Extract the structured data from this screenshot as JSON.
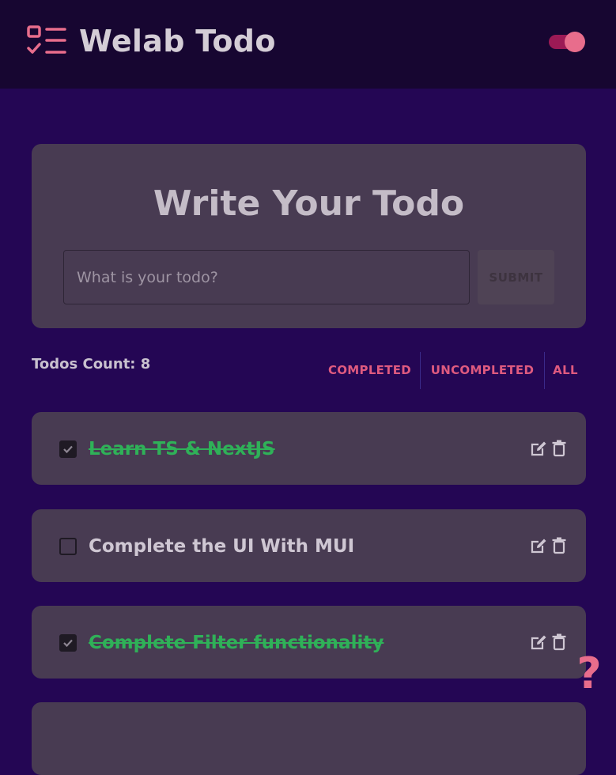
{
  "header": {
    "title": "Welab Todo",
    "logo_icon": "checklist-icon",
    "theme_toggle_on": true
  },
  "form": {
    "title": "Write Your Todo",
    "input_placeholder": "What is your todo?",
    "input_value": "",
    "submit_label": "SUBMIT"
  },
  "stats": {
    "count_label": "Todos Count: 8"
  },
  "filters": {
    "completed": "COMPLETED",
    "uncompleted": "UNCOMPLETED",
    "all": "ALL"
  },
  "todos": [
    {
      "text": "Learn TS & NextJS",
      "completed": true
    },
    {
      "text": "Complete the UI With MUI",
      "completed": false
    },
    {
      "text": "Complete Filter functionality",
      "completed": true
    }
  ],
  "help": {
    "glyph": "?"
  },
  "colors": {
    "background": "#240654",
    "app_bar": "#170631",
    "card": "#483b52",
    "accent": "#e86d8c",
    "completed_text": "#2fb158"
  }
}
